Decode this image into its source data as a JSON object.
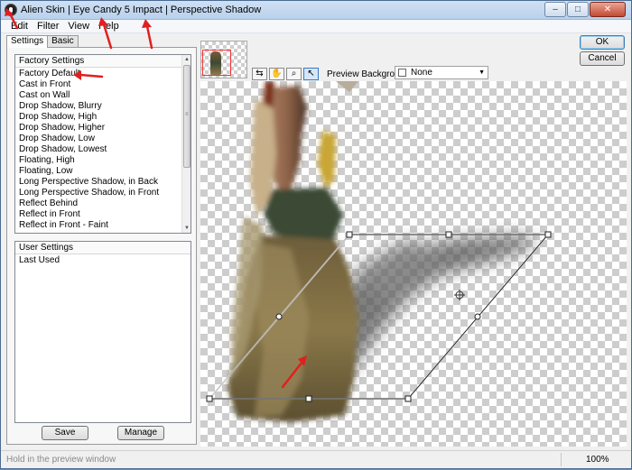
{
  "window": {
    "title": "Alien Skin | Eye Candy 5 Impact | Perspective Shadow",
    "buttons": {
      "minimize": "–",
      "maximize": "□",
      "close": "✕"
    }
  },
  "menu": [
    "Edit",
    "Filter",
    "View",
    "Help"
  ],
  "tabs": [
    {
      "label": "Settings",
      "active": true
    },
    {
      "label": "Basic",
      "active": false
    }
  ],
  "factory_settings": {
    "header": "Factory Settings",
    "selected": "Factory Default",
    "items": [
      "Factory Default",
      "Cast in Front",
      "Cast on Wall",
      "Drop Shadow, Blurry",
      "Drop Shadow, High",
      "Drop Shadow, Higher",
      "Drop Shadow, Low",
      "Drop Shadow, Lowest",
      "Floating, High",
      "Floating, Low",
      "Long Perspective Shadow, in Back",
      "Long Perspective Shadow, in Front",
      "Reflect Behind",
      "Reflect in Front",
      "Reflect in Front - Faint"
    ]
  },
  "user_settings": {
    "header": "User Settings",
    "items": [
      "Last Used"
    ]
  },
  "panel_buttons": {
    "save": "Save",
    "manage": "Manage"
  },
  "dialog_buttons": {
    "ok": "OK",
    "cancel": "Cancel"
  },
  "preview_background": {
    "label": "Preview Background:",
    "value": "None"
  },
  "tools": [
    "compare-icon",
    "hand-icon",
    "zoom-icon",
    "pointer-icon"
  ],
  "status": {
    "hint": "Hold in the preview window",
    "zoom": "100%"
  },
  "colors": {
    "annotation_arrow": "#e02020",
    "selection_frame": "#e33333"
  }
}
